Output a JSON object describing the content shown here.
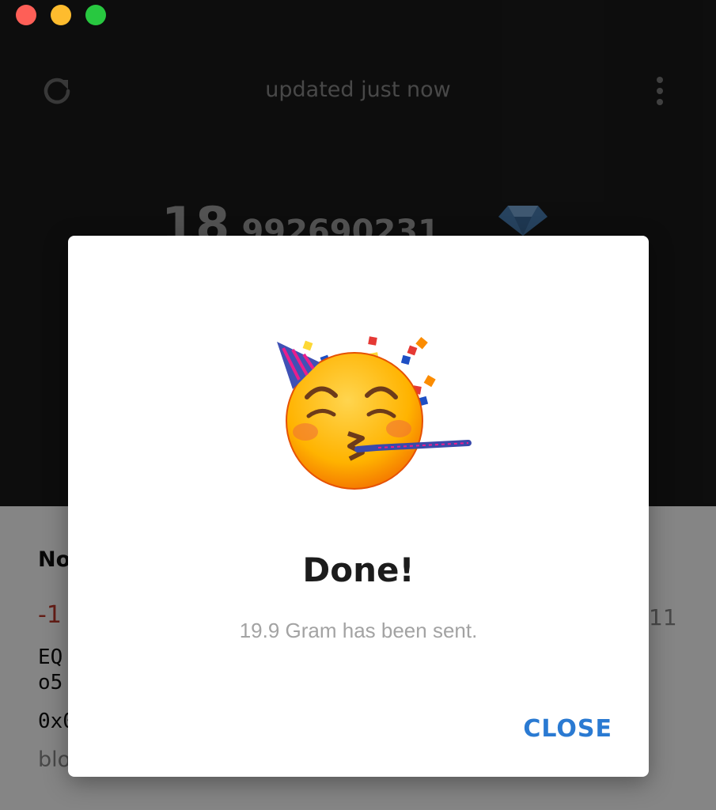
{
  "window": {
    "controls": [
      "close",
      "minimize",
      "zoom"
    ]
  },
  "header": {
    "status": "updated just now",
    "refresh_icon": "refresh-icon",
    "menu_icon": "more-vertical-icon"
  },
  "balance": {
    "integer": "18",
    "fraction": ".992690231",
    "currency_icon": "gram-diamond-icon"
  },
  "transaction": {
    "title_partial": "No",
    "amount_partial": "-1",
    "time_partial": "11",
    "address_partial": "EQ\no5",
    "hash_partial": "0x0",
    "meta_partial": "blo"
  },
  "dialog": {
    "icon": "party-face-emoji",
    "title": "Done!",
    "message": "19.9 Gram has been sent.",
    "close_label": "CLOSE"
  },
  "colors": {
    "accent": "#2a7ad2",
    "negative": "#c0392b",
    "header_bg": "#1a1a1a"
  }
}
